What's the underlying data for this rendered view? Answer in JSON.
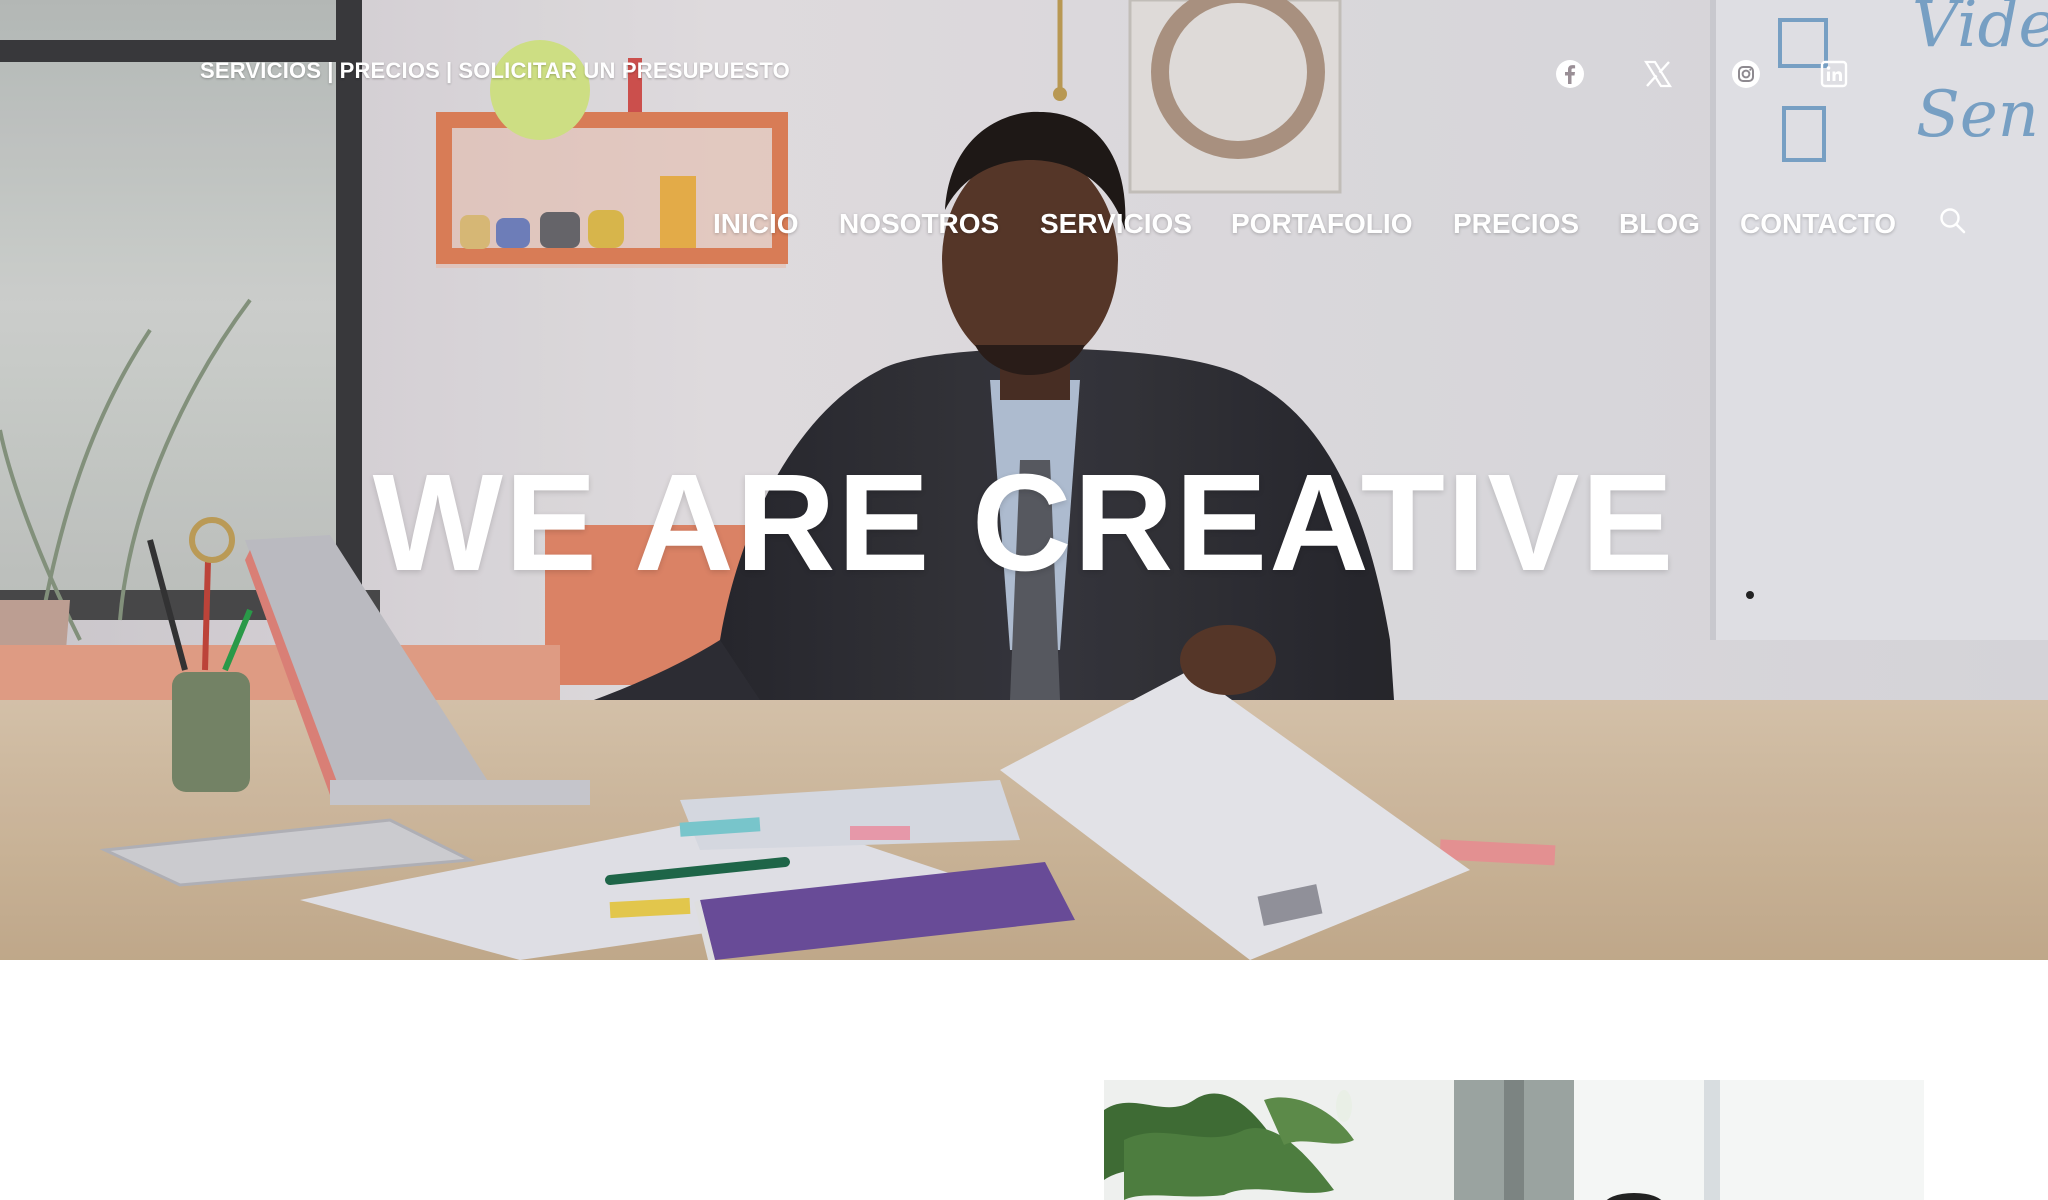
{
  "topbar": {
    "links": [
      {
        "label": "SERVICIOS"
      },
      {
        "label": "PRECIOS"
      },
      {
        "label": "SOLICITAR UN PRESUPUESTO"
      }
    ],
    "separator": "|"
  },
  "social": {
    "icons": [
      {
        "name": "facebook-icon"
      },
      {
        "name": "x-twitter-icon"
      },
      {
        "name": "instagram-icon"
      },
      {
        "name": "linkedin-icon"
      }
    ]
  },
  "nav": {
    "items": [
      {
        "label": "INICIO"
      },
      {
        "label": "NOSOTROS"
      },
      {
        "label": "SERVICIOS"
      },
      {
        "label": "PORTAFOLIO"
      },
      {
        "label": "PRECIOS"
      },
      {
        "label": "BLOG"
      },
      {
        "label": "CONTACTO"
      }
    ],
    "search_icon": "search-icon"
  },
  "hero": {
    "title": "WE ARE CREATIVE"
  },
  "whiteboard": {
    "text_line1": "Vide",
    "text_line2": "Sen"
  },
  "colors": {
    "nav_text": "#ffffff",
    "wall": "#e9e7ea",
    "shelf": "#e8845a",
    "desk": "#dcc3a4",
    "notebook": "#6e4fa0"
  }
}
